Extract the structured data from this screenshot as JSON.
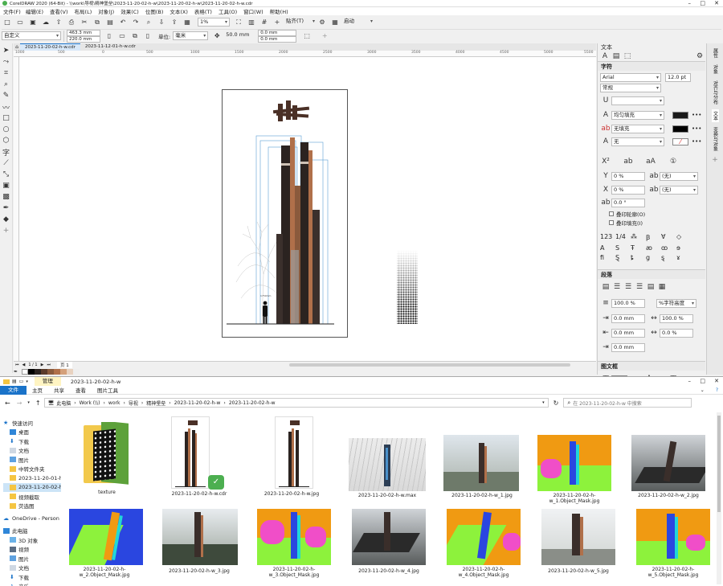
{
  "app": {
    "title": "CorelDRAW 2020 (64-Bit) - \\\\work\\导视\\精神堡垒\\2023-11-20-02-h-w\\2023-11-20-02-h-w\\2023-11-20-02-h-w.cdr",
    "menu": [
      "文件(F)",
      "编辑(E)",
      "查看(V)",
      "布局(L)",
      "对象(J)",
      "效果(C)",
      "位图(B)",
      "文本(X)",
      "表格(T)",
      "工具(O)",
      "窗口(W)",
      "帮助(H)"
    ],
    "zoom": "1%",
    "snap_label": "贴齐(T)",
    "launch_label": "启动",
    "preset": "自定义",
    "width": "463.3 mm",
    "height": "220.0 mm",
    "units_label": "单位:",
    "units": "毫米",
    "nudge": "50.0 mm",
    "dup_x": "0.0 mm",
    "dup_y": "0.0 mm",
    "doc_tabs": [
      "2023-11-20-02-h-w.cdr",
      "2023-11-12-01-h-w.cdr"
    ],
    "ruler_labels": [
      "1000",
      "500",
      "0",
      "500",
      "1000",
      "1500",
      "2000",
      "2500",
      "3000",
      "3500",
      "4000",
      "4500",
      "5000",
      "5500"
    ],
    "page_tab": "页 1",
    "artwork_label": "1750mm"
  },
  "text_panel": {
    "title": "文本",
    "section_char": "字符",
    "font": "Arial",
    "size": "12.0 pt",
    "style": "常规",
    "fill1": "均匀填充",
    "fill2": "无填充",
    "outline": "无",
    "offset1": "0 %",
    "offset1_unit": "(无)",
    "offset2": "0 %",
    "offset2_unit": "(无)",
    "angle": "0.0 °",
    "check1": "叠印轮廓(O)",
    "check2": "叠印填充(I)",
    "section_para": "段落",
    "line_spacing": "100.0 %",
    "spacing_unit": "%字符高度",
    "char_spacing": "100.0 %",
    "indent1": "0.0 mm",
    "indent2": "0.0 mm",
    "word_spacing": "0.0 %",
    "indent3": "0.0 mm",
    "section_frame": "图文框",
    "side_tabs": [
      "属性",
      "对象",
      "对齐与分布",
      "文本",
      "变换与对象"
    ]
  },
  "explorer": {
    "ribbon_tool_group": "管理",
    "folder_title": "2023-11-20-02-h-w",
    "tabs": [
      "文件",
      "主页",
      "共享",
      "查看",
      "图片工具"
    ],
    "breadcrumb": [
      "此电脑",
      "Work (\\\\)",
      "work",
      "导视",
      "精神堡垒",
      "2023-11-20-02-h-w",
      "2023-11-20-02-h-w"
    ],
    "search_placeholder": "在 2023-11-20-02-h-w 中搜索",
    "nav": [
      "快速访问",
      "桌面",
      "下载",
      "文档",
      "图片",
      "中转文件夹",
      "2023-11-20-01-h",
      "2023-11-20-02-h-",
      "视频截取",
      "荧选图",
      "OneDrive - Person",
      "此电脑",
      "3D 对象",
      "视频",
      "图片",
      "文档",
      "下载",
      "音乐"
    ],
    "files": [
      "texture",
      "2023-11-20-02-h-w.cdr",
      "2023-11-20-02-h-w.jpg",
      "2023-11-20-02-h-w.max",
      "2023-11-20-02-h-w_1.jpg",
      "2023-11-20-02-h-w_1.Object_Mask.jpg",
      "2023-11-20-02-h-w_2.jpg",
      "2023-11-20-02-h-w_2.Object_Mask.jpg",
      "2023-11-20-02-h-w_3.jpg",
      "2023-11-20-02-h-w_3.Object_Mask.jpg",
      "2023-11-20-02-h-w_4.jpg",
      "2023-11-20-02-h-w_4.Object_Mask.jpg",
      "2023-11-20-02-h-w_5.jpg",
      "2023-11-20-02-h-w_5.Object_Mask.jpg"
    ]
  },
  "colors": {
    "accent": "#1a73c9",
    "tower_dark": "#2b2320",
    "tower_copper": "#b0704a",
    "mask_orange": "#f09a12",
    "mask_green": "#8df23c",
    "mask_pink": "#f04ec8"
  }
}
